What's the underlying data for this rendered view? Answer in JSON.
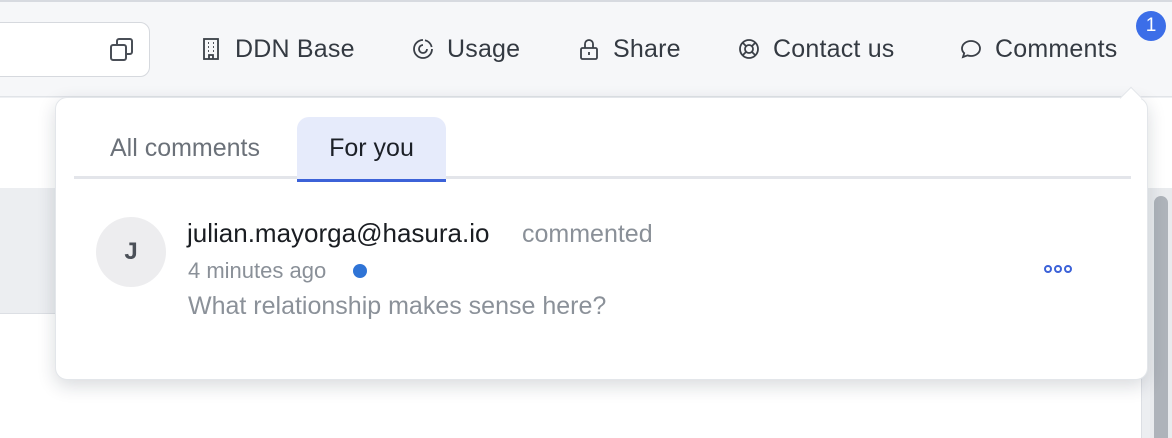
{
  "topbar": {
    "copy_icon": "copy-icon",
    "nav": [
      {
        "label": "DDN Base",
        "icon": "building-icon"
      },
      {
        "label": "Usage",
        "icon": "chart-pie-icon"
      },
      {
        "label": "Share",
        "icon": "lock-icon"
      },
      {
        "label": "Contact us",
        "icon": "lifebuoy-icon"
      },
      {
        "label": "Comments",
        "icon": "chat-bubble-icon"
      }
    ],
    "comments_badge": "1"
  },
  "comments_panel": {
    "tabs": [
      {
        "label": "All comments",
        "active": false
      },
      {
        "label": "For you",
        "active": true
      }
    ],
    "items": [
      {
        "avatar_initial": "J",
        "author": "julian.mayorga@hasura.io",
        "action": "commented",
        "time": "4 minutes ago",
        "unread": true,
        "text": "What relationship makes sense here?",
        "more_icon": "more-dots-icon"
      }
    ]
  },
  "colors": {
    "accent": "#3c62d8",
    "badge": "#3c6ee8",
    "unread_dot": "#2f74d6",
    "tab_active_bg": "#e6ebfb"
  }
}
